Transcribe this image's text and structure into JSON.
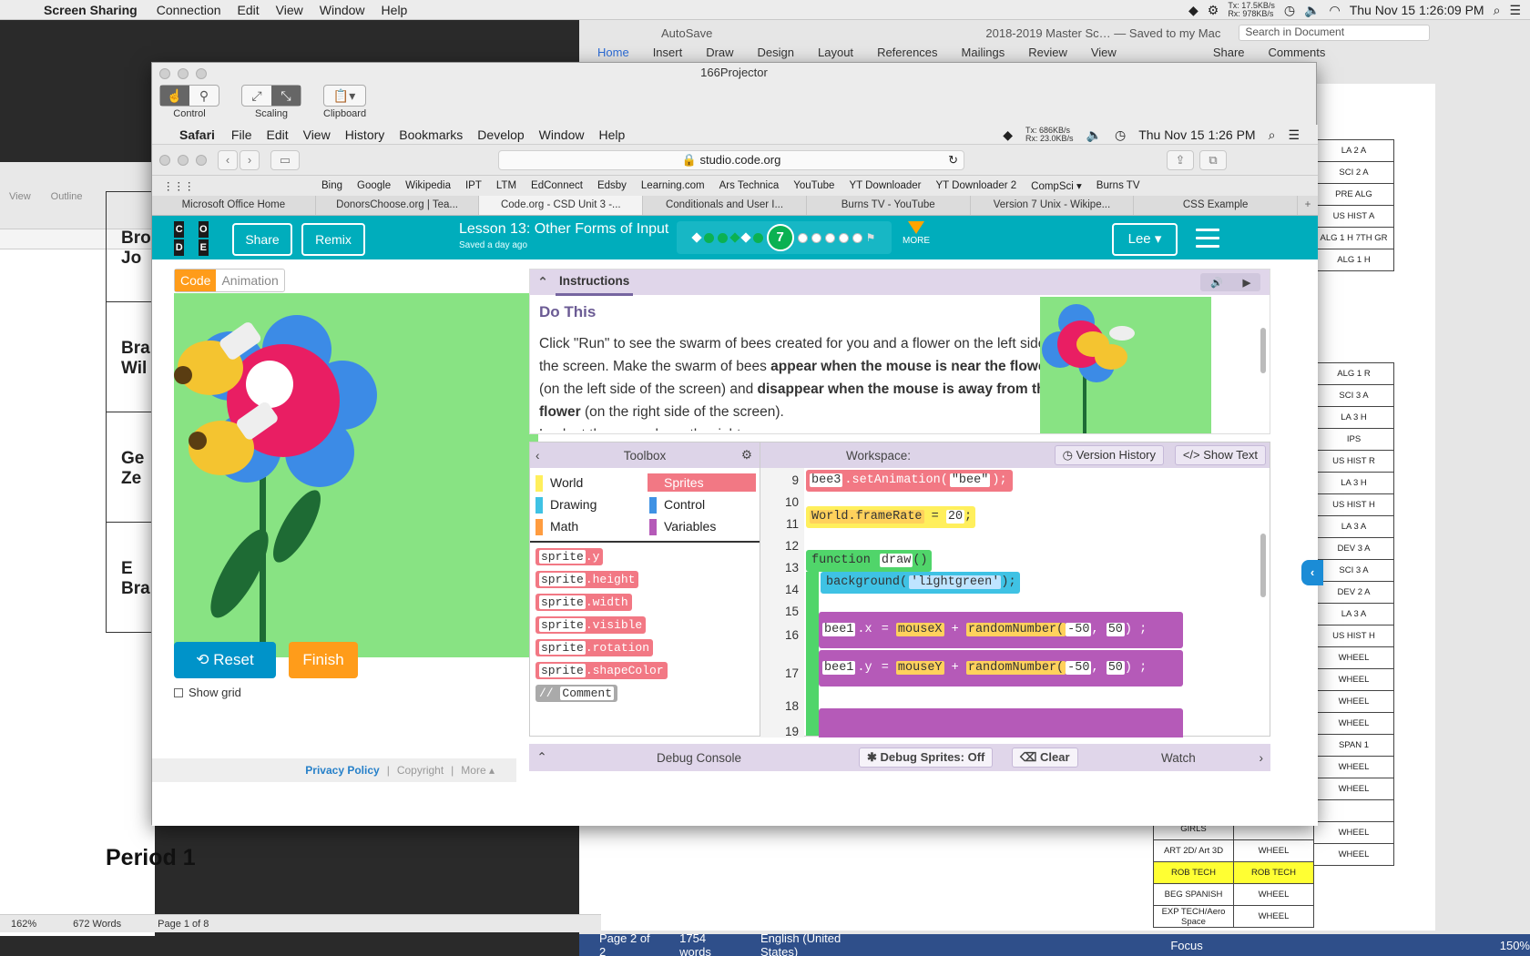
{
  "host_menu": {
    "app": "Screen Sharing",
    "items": [
      "Connection",
      "Edit",
      "View",
      "Window",
      "Help"
    ],
    "net_tx": "Tx: 17.5KB/s",
    "net_rx": "Rx: 978KB/s",
    "clock": "Thu Nov 15  1:26:09 PM"
  },
  "word": {
    "autosave": "AutoSave",
    "title": "2018-2019 Master Sc… — Saved to my Mac",
    "search": "Search in Document",
    "tabs": [
      "Home",
      "Insert",
      "Draw",
      "Design",
      "Layout",
      "References",
      "Mailings",
      "Review",
      "View"
    ],
    "share": "Share",
    "comments": "Comments",
    "col_a": [
      "LA 2 A",
      "SCI 2 A",
      "PRE ALG",
      "US HIST A",
      "ALG 1 H 7TH GR",
      "ALG 1 H"
    ],
    "col_b": [
      "ALG 1 R",
      "SCI 3 A",
      "LA 3 H",
      "IPS",
      "US HIST R",
      "LA 3 H",
      "US HIST H",
      "LA 3 A",
      "DEV 3 A",
      "SCI 3 A",
      "DEV 2 A",
      "LA 3 A",
      "US HIST H",
      "WHEEL",
      "WHEEL",
      "WHEEL",
      "WHEEL",
      "SPAN 1",
      "WHEEL",
      "WHEEL",
      "",
      "WHEEL",
      "WHEEL"
    ],
    "col_c": [
      "GIRLS",
      "ART 2D/ Art 3D",
      "ROB TECH",
      "BEG SPANISH",
      "EXP TECH/Aero Space"
    ],
    "col_d": [
      "",
      "WHEEL",
      "ROB TECH",
      "WHEEL",
      "WHEEL"
    ],
    "status": [
      "Page 2 of 2",
      "1754 words",
      "English (United States)",
      "Focus",
      "150%"
    ]
  },
  "left_word": {
    "view": "View",
    "outline": "Outline",
    "names": [
      "Bro Jo",
      "Bra Wil",
      "Ge Ze",
      "E Bra"
    ],
    "period": "Period 1",
    "status": [
      "162%",
      "672 Words",
      "Page 1 of 8"
    ]
  },
  "ss": {
    "title": "166Projector",
    "control": "Control",
    "scaling": "Scaling",
    "clipboard": "Clipboard"
  },
  "inner_menu": {
    "app": "Safari",
    "items": [
      "File",
      "Edit",
      "View",
      "History",
      "Bookmarks",
      "Develop",
      "Window",
      "Help"
    ],
    "net_tx": "Tx: 686KB/s",
    "net_rx": "Rx: 23.0KB/s",
    "clock": "Thu Nov 15  1:26 PM"
  },
  "safari": {
    "url": "studio.code.org",
    "bookmarks": [
      "Bing",
      "Google",
      "Wikipedia",
      "IPT",
      "LTM",
      "EdConnect",
      "Edsby",
      "Learning.com",
      "Ars Technica",
      "YouTube",
      "YT Downloader",
      "YT Downloader 2",
      "CompSci ▾",
      "Burns TV"
    ],
    "tabs": [
      "Microsoft Office Home",
      "DonorsChoose.org | Tea...",
      "Code.org - CSD Unit 3 -...",
      "Conditionals and User I...",
      "Burns TV - YouTube",
      "Version 7 Unix - Wikipe...",
      "CSS Example"
    ]
  },
  "cdo": {
    "logo": [
      "C",
      "O",
      "D",
      "E"
    ],
    "share": "Share",
    "remix": "Remix",
    "lesson_title": "Lesson 13: Other Forms of Input",
    "saved": "Saved a day ago",
    "current_level": "7",
    "more": "MORE",
    "user": "Lee",
    "code_tab": "Code",
    "anim_tab": "Animation",
    "reset": "Reset",
    "finish": "Finish",
    "show_grid": "Show grid",
    "footer": [
      "Privacy Policy",
      "Copyright",
      "More ▴"
    ],
    "instructions_label": "Instructions",
    "do_this": "Do This",
    "instr_1": "Click \"Run\" to see the swarm of bees created for you and a flower on the left side of the screen. Make the swarm of bees ",
    "instr_b1": "appear when the mouse is near the flower",
    "instr_2": " (on the left side of the screen) and ",
    "instr_b2": "disappear when the mouse is away from the flower",
    "instr_3": " (on the right side of the screen).",
    "instr_4": "Look at the example on the right.",
    "toolbox": "Toolbox",
    "workspace": "Workspace:",
    "version_history": "Version History",
    "show_text": "Show Text",
    "categories": [
      {
        "name": "World",
        "color": "#ffef5c"
      },
      {
        "name": "Sprites",
        "color": "#f27884"
      },
      {
        "name": "Drawing",
        "color": "#3fc2e4"
      },
      {
        "name": "Control",
        "color": "#3f92e4"
      },
      {
        "name": "Math",
        "color": "#ff9c3f"
      },
      {
        "name": "Variables",
        "color": "#b55ab8"
      }
    ],
    "blocks": [
      "y",
      "height",
      "width",
      "visible",
      "rotation",
      "shapeColor"
    ],
    "block_obj": "sprite",
    "comment": "Comment",
    "line_numbers": [
      "9",
      "10",
      "11",
      "12",
      "13",
      "14",
      "15",
      "16",
      "17",
      "18",
      "19"
    ],
    "code": {
      "l9": "bee3",
      "l9m": ".setAnimation(",
      "l9a": "\"bee\"",
      "l11": "World.frameRate",
      "l11v": "20",
      "l13": "function",
      "l13n": "draw",
      "l14": "background(",
      "l14a": "'lightgreen'",
      "l16o": "bee1",
      "l16p": ".x",
      "l16m": "mouseX",
      "l17p": ".y",
      "l17m": "mouseY",
      "rnd": "randomNumber(",
      "a1": "-50",
      "a2": "50"
    },
    "debug_console": "Debug Console",
    "debug_sprites": "Debug Sprites: Off",
    "clear": "Clear",
    "watch": "Watch"
  }
}
